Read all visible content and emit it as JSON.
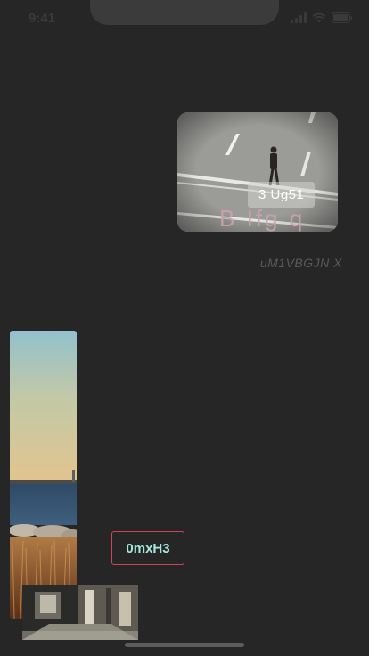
{
  "status_bar": {
    "time": "9:41"
  },
  "card": {
    "badge": "3 Ug51",
    "caption": "B Ifg q"
  },
  "italic_label": "uM1VBGJN X",
  "chip_button": "0mxH3",
  "icons": {
    "signal": "signal-icon",
    "wifi": "wifi-icon",
    "battery": "battery-icon"
  }
}
